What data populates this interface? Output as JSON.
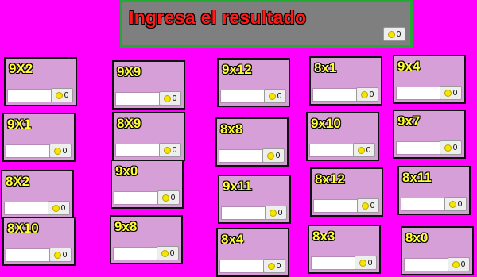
{
  "header": {
    "title": "Ingresa el resultado",
    "score": "0"
  },
  "cards": [
    {
      "label": "9X2",
      "count": "0",
      "value": ""
    },
    {
      "label": "9X9",
      "count": "0",
      "value": ""
    },
    {
      "label": "9x12",
      "count": "0",
      "value": ""
    },
    {
      "label": "8x1",
      "count": "0",
      "value": ""
    },
    {
      "label": "9x4",
      "count": "0",
      "value": ""
    },
    {
      "label": "9X1",
      "count": "0",
      "value": ""
    },
    {
      "label": "8X9",
      "count": "0",
      "value": ""
    },
    {
      "label": "8x8",
      "count": "0",
      "value": ""
    },
    {
      "label": "9x10",
      "count": "0",
      "value": ""
    },
    {
      "label": "9x7",
      "count": "0",
      "value": ""
    },
    {
      "label": "8X2",
      "count": "0",
      "value": ""
    },
    {
      "label": "9x0",
      "count": "0",
      "value": ""
    },
    {
      "label": "9x11",
      "count": "0",
      "value": ""
    },
    {
      "label": "8x12",
      "count": "0",
      "value": ""
    },
    {
      "label": "8x11",
      "count": "0",
      "value": ""
    },
    {
      "label": "8X10",
      "count": "0",
      "value": ""
    },
    {
      "label": "9x8",
      "count": "0",
      "value": ""
    },
    {
      "label": "8x4",
      "count": "0",
      "value": ""
    },
    {
      "label": "8x3",
      "count": "0",
      "value": ""
    },
    {
      "label": "8x0",
      "count": "0",
      "value": ""
    }
  ],
  "colors": {
    "background": "#ff00ff",
    "card": "#d79fd7",
    "label": "#ffff33",
    "title": "#ff1a1a",
    "coin": "#f5e600"
  },
  "icons": {
    "coin": "coin-icon"
  }
}
